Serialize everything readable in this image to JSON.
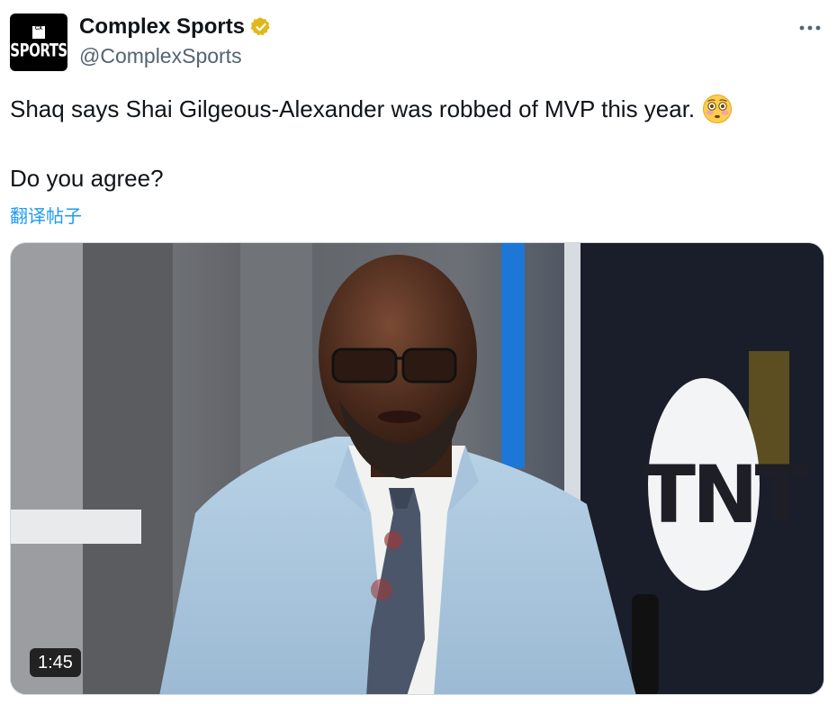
{
  "account": {
    "display_name": "Complex Sports",
    "handle": "@ComplexSports",
    "avatar_logo_top": "CX",
    "avatar_logo_text": "SPORTS"
  },
  "tweet": {
    "text_line1": "Shaq says Shai Gilgeous-Alexander was robbed of MVP this year.",
    "text_line2": "Do you agree?",
    "translate_label": "翻译帖子"
  },
  "media": {
    "duration": "1:45",
    "network_logo": "TNT"
  },
  "icons": {
    "verified": "verified-badge-icon",
    "more": "more-icon",
    "emoji": "flushed-face-emoji"
  },
  "colors": {
    "link": "#1d9bf0",
    "verified_gold": "#e2b719",
    "secondary_text": "#536471"
  }
}
